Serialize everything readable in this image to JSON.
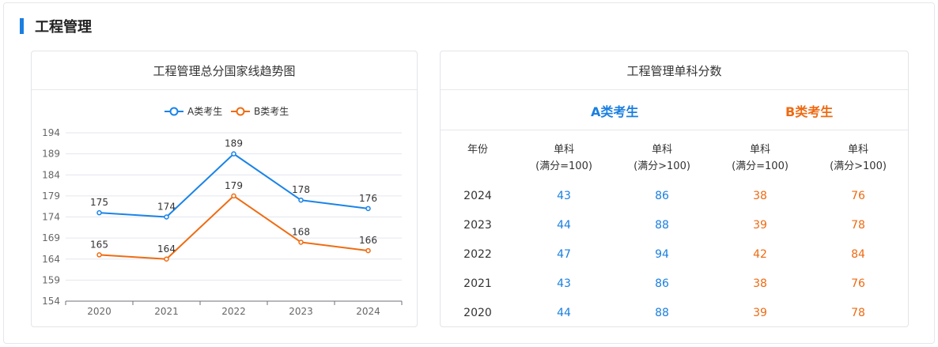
{
  "section": {
    "title": "工程管理"
  },
  "left_card": {
    "title": "工程管理总分国家线趋势图"
  },
  "right_card": {
    "title": "工程管理单科分数",
    "group_a": "A类考生",
    "group_b": "B类考生",
    "headers": {
      "year": "年份",
      "col1_line1": "单科",
      "col1_line2": "(满分=100)",
      "col2_line1": "单科",
      "col2_line2": "(满分>100)",
      "col3_line1": "单科",
      "col3_line2": "(满分=100)",
      "col4_line1": "单科",
      "col4_line2": "(满分>100)"
    },
    "rows": [
      {
        "year": "2024",
        "a1": "43",
        "a2": "86",
        "b1": "38",
        "b2": "76"
      },
      {
        "year": "2023",
        "a1": "44",
        "a2": "88",
        "b1": "39",
        "b2": "78"
      },
      {
        "year": "2022",
        "a1": "47",
        "a2": "94",
        "b1": "42",
        "b2": "84"
      },
      {
        "year": "2021",
        "a1": "43",
        "a2": "86",
        "b1": "38",
        "b2": "76"
      },
      {
        "year": "2020",
        "a1": "44",
        "a2": "88",
        "b1": "39",
        "b2": "78"
      }
    ]
  },
  "chart_data": {
    "type": "line",
    "title": "工程管理总分国家线趋势图",
    "x": [
      "2020",
      "2021",
      "2022",
      "2023",
      "2024"
    ],
    "series": [
      {
        "name": "A类考生",
        "color": "#1a84e8",
        "values": [
          175,
          174,
          189,
          178,
          176
        ]
      },
      {
        "name": "B类考生",
        "color": "#ef6c12",
        "values": [
          165,
          164,
          179,
          168,
          166
        ]
      }
    ],
    "ylim": [
      154,
      194
    ],
    "yticks": [
      154,
      159,
      164,
      169,
      174,
      179,
      184,
      189,
      194
    ],
    "grid": true,
    "legend": "top-center"
  }
}
